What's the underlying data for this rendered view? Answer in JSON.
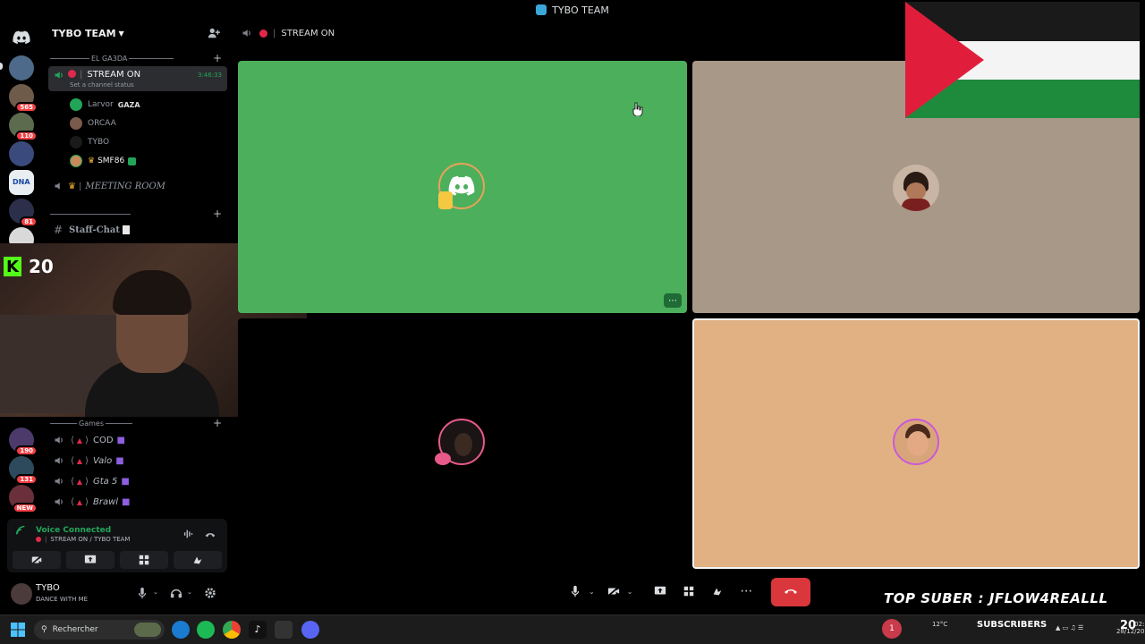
{
  "window": {
    "title": "TYBO TEAM"
  },
  "servers": [
    {
      "badge": ""
    },
    {
      "badge": "565"
    },
    {
      "badge": "110"
    },
    {
      "badge": ""
    },
    {
      "badge": ""
    },
    {
      "badge": "81"
    },
    {
      "badge": ""
    }
  ],
  "servers_lower": [
    {
      "badge": "190"
    },
    {
      "badge": "131"
    },
    {
      "badge": "NEW"
    }
  ],
  "guild": {
    "name": "TYBO TEAM"
  },
  "categories": {
    "el_gaada": "EL GA3DA",
    "games": "Games"
  },
  "channels": {
    "stream_on": {
      "name": "STREAM ON",
      "time": "3:46:33",
      "status": "Set a channel status"
    },
    "meeting_room": {
      "name": "MEETING ROOM"
    },
    "staff_chat": {
      "name": "Staff-Chat"
    },
    "games": [
      "COD",
      "Valo",
      "Gta 5",
      "Brawl"
    ]
  },
  "members": [
    {
      "name": "Larvor",
      "tag": "GAZA"
    },
    {
      "name": "ORCAA",
      "tag": ""
    },
    {
      "name": "TYBO",
      "tag": ""
    },
    {
      "name": "SMF86",
      "tag": ""
    }
  ],
  "webcam_overlay": {
    "follower_count": "20"
  },
  "voice": {
    "title": "Voice Connected",
    "subtitle": "STREAM ON / TYBO TEAM"
  },
  "user": {
    "name": "TYBO",
    "status": "DANCE WITH ME"
  },
  "call": {
    "channel_name": "STREAM ON"
  },
  "overlays": {
    "top_suber": "TOP SUBER : JFLOW4REALLL",
    "subscribers": "SUBSCRIBERS",
    "subs_count": "1",
    "big_time": "20"
  },
  "taskbar": {
    "search_placeholder": "Rechercher",
    "weather": "12°C",
    "time": "02:20",
    "date": "28/12/2025"
  },
  "colors": {
    "green_tile": "#4caf5c",
    "gray_tile": "#a89888",
    "peach_tile": "#e1b083",
    "hangup": "#da373c",
    "voice_green": "#23a559"
  }
}
